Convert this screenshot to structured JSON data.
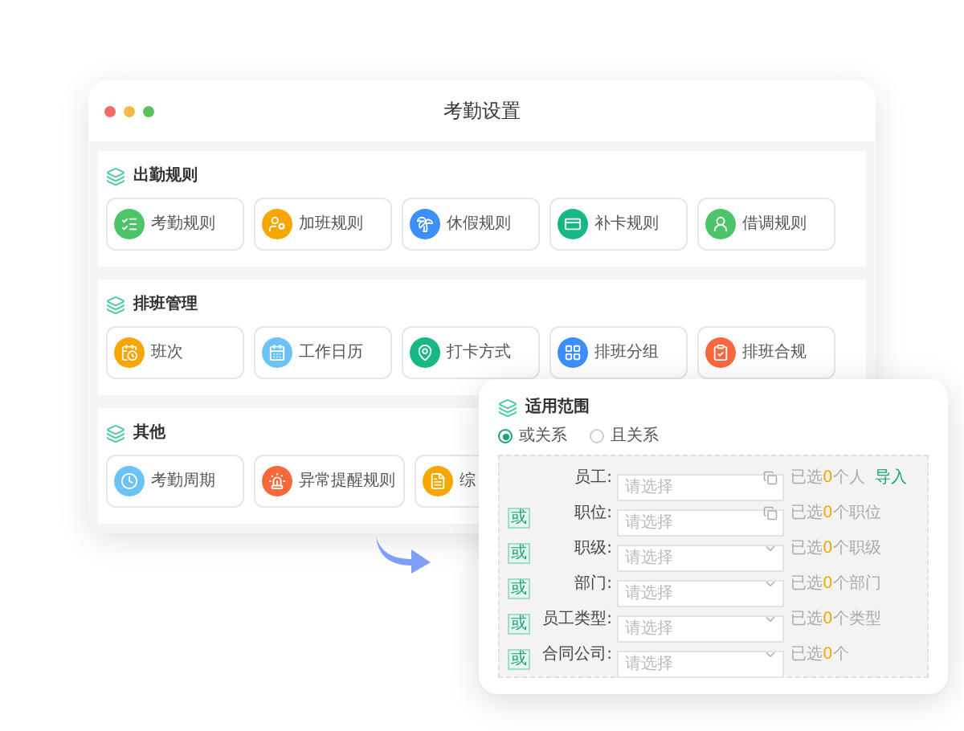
{
  "window": {
    "title": "考勤设置"
  },
  "sections": [
    {
      "title": "出勤规则",
      "items": [
        {
          "label": "考勤规则",
          "color": "#4cc46a"
        },
        {
          "label": "加班规则",
          "color": "#f7a600"
        },
        {
          "label": "休假规则",
          "color": "#3d8ef7"
        },
        {
          "label": "补卡规则",
          "color": "#17b885"
        },
        {
          "label": "借调规则",
          "color": "#4cc46a"
        }
      ]
    },
    {
      "title": "排班管理",
      "items": [
        {
          "label": "班次",
          "color": "#f7a600"
        },
        {
          "label": "工作日历",
          "color": "#6cc1f5"
        },
        {
          "label": "打卡方式",
          "color": "#17b885"
        },
        {
          "label": "排班分组",
          "color": "#3d8ef7"
        },
        {
          "label": "排班合规",
          "color": "#f7683c"
        }
      ]
    },
    {
      "title": "其他",
      "items": [
        {
          "label": "考勤周期",
          "color": "#6cc1f5"
        },
        {
          "label": "异常提醒规则",
          "color": "#f7683c"
        },
        {
          "label": "综",
          "color": "#f7a600"
        }
      ]
    }
  ],
  "scope_panel": {
    "title": "适用范围",
    "relations": [
      {
        "label": "或关系",
        "selected": true
      },
      {
        "label": "且关系",
        "selected": false
      }
    ],
    "rows": [
      {
        "tag": null,
        "label": "员工:",
        "placeholder": "请选择",
        "kind": "picker",
        "before": "已选",
        "count": "0",
        "after": "个人",
        "action": "导入"
      },
      {
        "tag": "或",
        "label": "职位:",
        "placeholder": "请选择",
        "kind": "picker",
        "before": "已选",
        "count": "0",
        "after": "个职位"
      },
      {
        "tag": "或",
        "label": "职级:",
        "placeholder": "请选择",
        "kind": "dropdown",
        "before": "已选",
        "count": "0",
        "after": "个职级"
      },
      {
        "tag": "或",
        "label": "部门:",
        "placeholder": "请选择",
        "kind": "dropdown",
        "before": "已选",
        "count": "0",
        "after": "个部门"
      },
      {
        "tag": "或",
        "label": "员工类型:",
        "placeholder": "请选择",
        "kind": "dropdown",
        "before": "已选",
        "count": "0",
        "after": "个类型"
      },
      {
        "tag": "或",
        "label": "合同公司:",
        "placeholder": "请选择",
        "kind": "dropdown",
        "before": "已选",
        "count": "0",
        "after": "个"
      }
    ]
  }
}
